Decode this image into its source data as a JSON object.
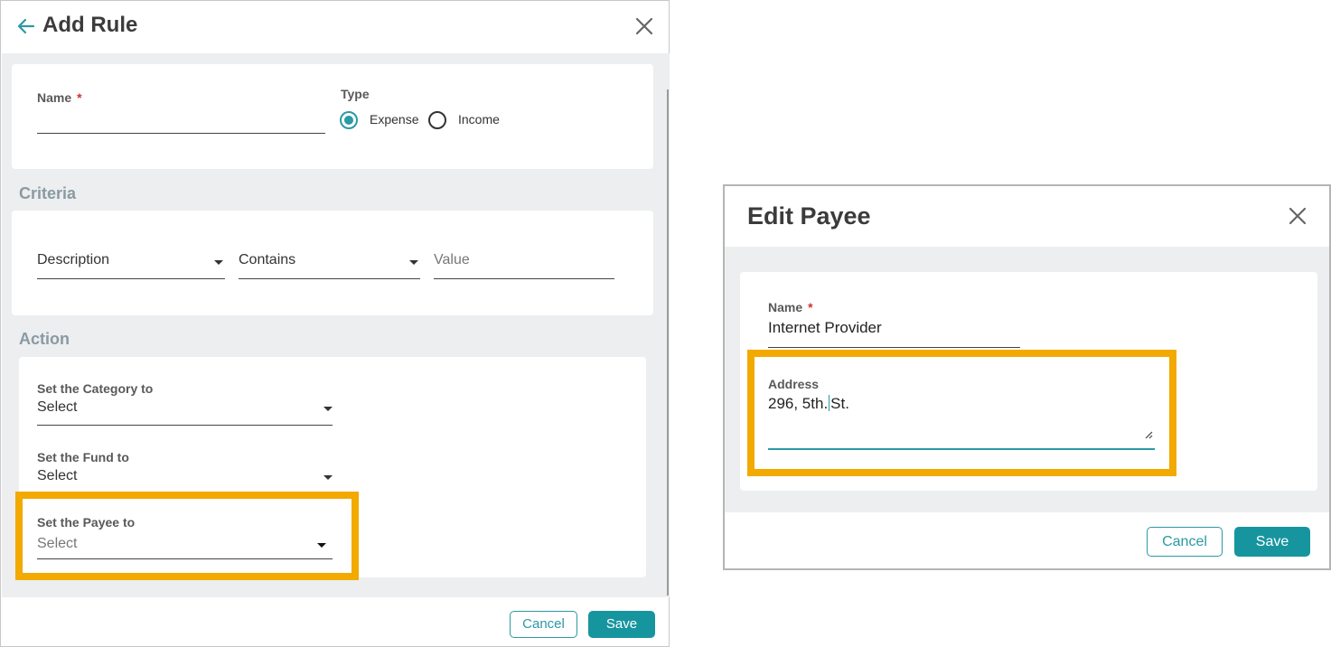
{
  "add_rule": {
    "title": "Add Rule",
    "name_label": "Name",
    "required_mark": "*",
    "name_value": "",
    "type_label": "Type",
    "type_options": [
      "Expense",
      "Income"
    ],
    "type_selected": "Expense",
    "criteria_heading": "Criteria",
    "criteria": {
      "field": "Description",
      "operator": "Contains",
      "value_placeholder": "Value"
    },
    "action_heading": "Action",
    "actions": [
      {
        "label": "Set the Category to",
        "value": "Select"
      },
      {
        "label": "Set the Fund to",
        "value": "Select"
      },
      {
        "label": "Set the Payee to",
        "value": "Select"
      }
    ],
    "cancel_label": "Cancel",
    "save_label": "Save"
  },
  "edit_payee": {
    "title": "Edit Payee",
    "name_label": "Name",
    "required_mark": "*",
    "name_value": "Internet Provider",
    "address_label": "Address",
    "address_before_cursor": "296, 5th.",
    "address_after_cursor": "St.",
    "cancel_label": "Cancel",
    "save_label": "Save"
  },
  "colors": {
    "accent": "#17959e",
    "highlight": "#f2a900",
    "required": "#d0312d",
    "panel_bg": "#eceeef"
  },
  "icons": [
    "back-arrow-icon",
    "close-icon",
    "chevron-down-icon",
    "resize-handle-icon"
  ]
}
